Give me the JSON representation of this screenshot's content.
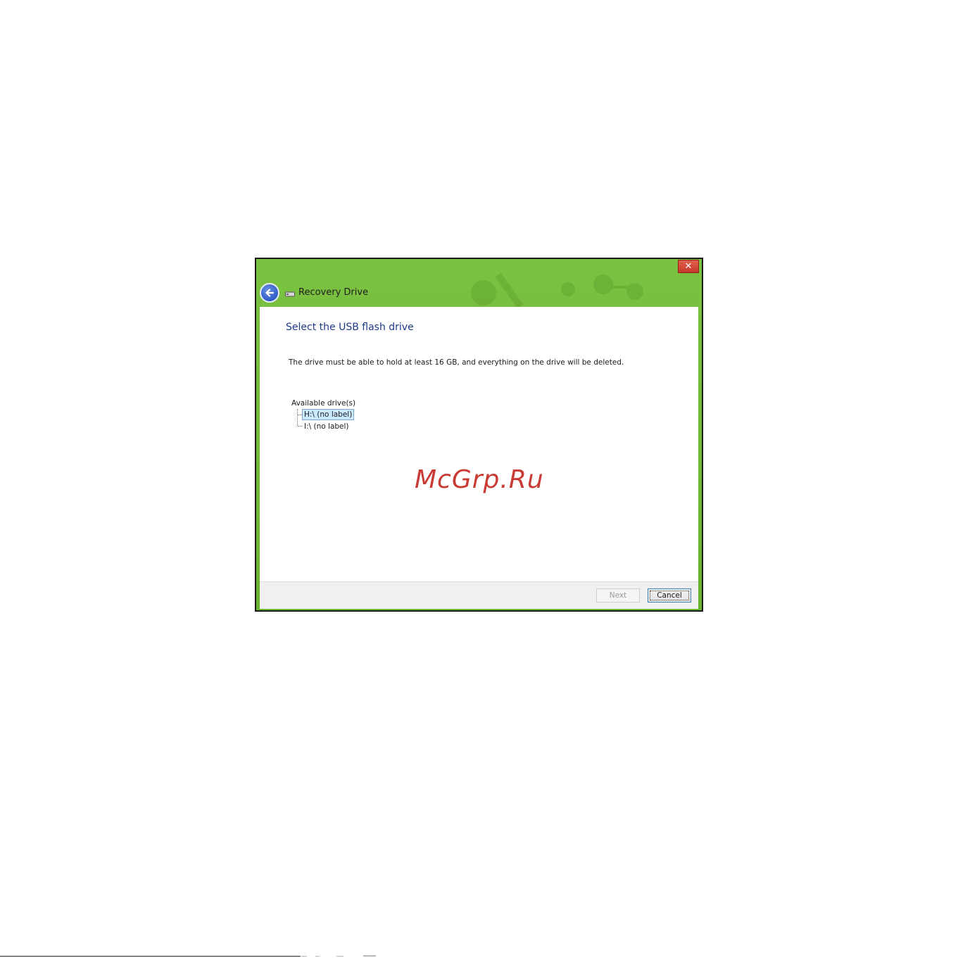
{
  "window": {
    "title": "Recovery Drive",
    "close_label": "✕",
    "accent_color": "#6ab32f"
  },
  "icons": {
    "back": "back-arrow-icon",
    "drive": "usb-drive-icon",
    "close": "close-icon"
  },
  "content": {
    "heading": "Select the USB flash drive",
    "description": "The drive must be able to hold at least 16 GB, and everything on the drive will be deleted.",
    "tree": {
      "root_label": "Available drive(s)",
      "items": [
        {
          "label": "H:\\ (no label)",
          "selected": true
        },
        {
          "label": "I:\\ (no label)",
          "selected": false
        }
      ]
    },
    "watermark": "McGrp.Ru"
  },
  "footer": {
    "next_label": "Next",
    "cancel_label": "Cancel"
  }
}
